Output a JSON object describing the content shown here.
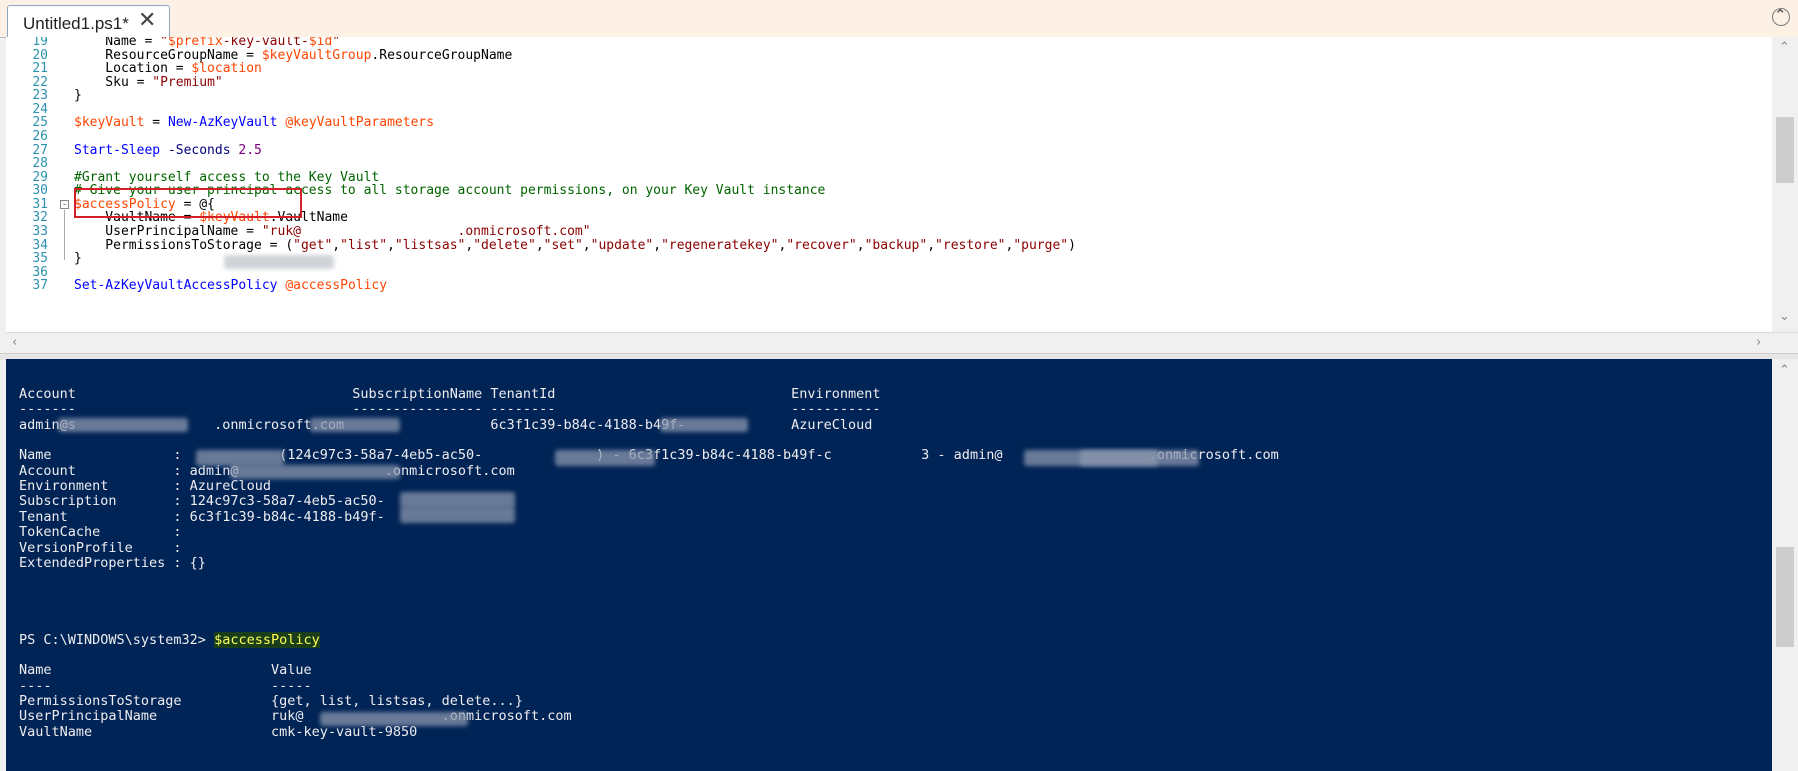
{
  "tab": {
    "title": "Untitled1.ps1*",
    "close": "✕"
  },
  "collapse_icon": "⌃",
  "editor": {
    "lines": [
      {
        "n": "19",
        "text": "    Name = \"$prefix-key-vault-$id\""
      },
      {
        "n": "20",
        "text": "    ResourceGroupName = $keyVaultGroup.ResourceGroupName"
      },
      {
        "n": "21",
        "text": "    Location = $location"
      },
      {
        "n": "22",
        "text": "    Sku = \"Premium\""
      },
      {
        "n": "23",
        "text": "}"
      },
      {
        "n": "24",
        "text": ""
      },
      {
        "n": "25",
        "text": "$keyVault = New-AzKeyVault @keyVaultParameters"
      },
      {
        "n": "26",
        "text": ""
      },
      {
        "n": "27",
        "text": "Start-Sleep -Seconds 2.5"
      },
      {
        "n": "28",
        "text": ""
      },
      {
        "n": "29",
        "text": "#Grant yourself access to the Key Vault"
      },
      {
        "n": "30",
        "text": "# Give your user principal access to all storage account permissions, on your Key Vault instance"
      },
      {
        "n": "31",
        "text": "$accessPolicy = @{"
      },
      {
        "n": "32",
        "text": "    VaultName = $keyVault.VaultName"
      },
      {
        "n": "33",
        "text": "    UserPrincipalName = \"ruk@                    .onmicrosoft.com\""
      },
      {
        "n": "34",
        "text": "    PermissionsToStorage = (\"get\",\"list\",\"listsas\",\"delete\",\"set\",\"update\",\"regeneratekey\",\"recover\",\"backup\",\"restore\",\"purge\")"
      },
      {
        "n": "35",
        "text": "}"
      },
      {
        "n": "36",
        "text": ""
      },
      {
        "n": "37",
        "text": "Set-AzKeyVaultAccessPolicy @accessPolicy"
      }
    ]
  },
  "console": {
    "lines": [
      {
        "text": "Account                                  SubscriptionName TenantId                             Environment"
      },
      {
        "text": "-------                                  ---------------- --------                             -----------"
      },
      {
        "text": "admin@s                 .onmicrosoft.com                  6c3f1c39-b84c-4188-b49f-             AzureCloud"
      },
      {
        "text": ""
      },
      {
        "text": "Name               :            (124c97c3-58a7-4eb5-ac50-              ) - 6c3f1c39-b84c-4188-b49f-c           3 - admin@                  .onmicrosoft.com"
      },
      {
        "text": "Account            : admin@                  .onmicrosoft.com"
      },
      {
        "text": "Environment        : AzureCloud"
      },
      {
        "text": "Subscription       : 124c97c3-58a7-4eb5-ac50-"
      },
      {
        "text": "Tenant             : 6c3f1c39-b84c-4188-b49f-"
      },
      {
        "text": "TokenCache         :"
      },
      {
        "text": "VersionProfile     :"
      },
      {
        "text": "ExtendedProperties : {}"
      },
      {
        "text": ""
      },
      {
        "text": ""
      },
      {
        "text": ""
      },
      {
        "text": ""
      },
      {
        "text": "PS C:\\WINDOWS\\system32> "
      },
      {
        "text": ""
      },
      {
        "text": "Name                           Value"
      },
      {
        "text": "----                           -----"
      },
      {
        "text": "PermissionsToStorage           {get, list, listsas, delete...}"
      },
      {
        "text": "UserPrincipalName              ruk@                 .onmicrosoft.com"
      },
      {
        "text": "VaultName                      cmk-key-vault-9850"
      }
    ],
    "command": "$accessPolicy"
  },
  "colors": {
    "console_bg": "#012456",
    "highlight_border": "#d41f27"
  }
}
